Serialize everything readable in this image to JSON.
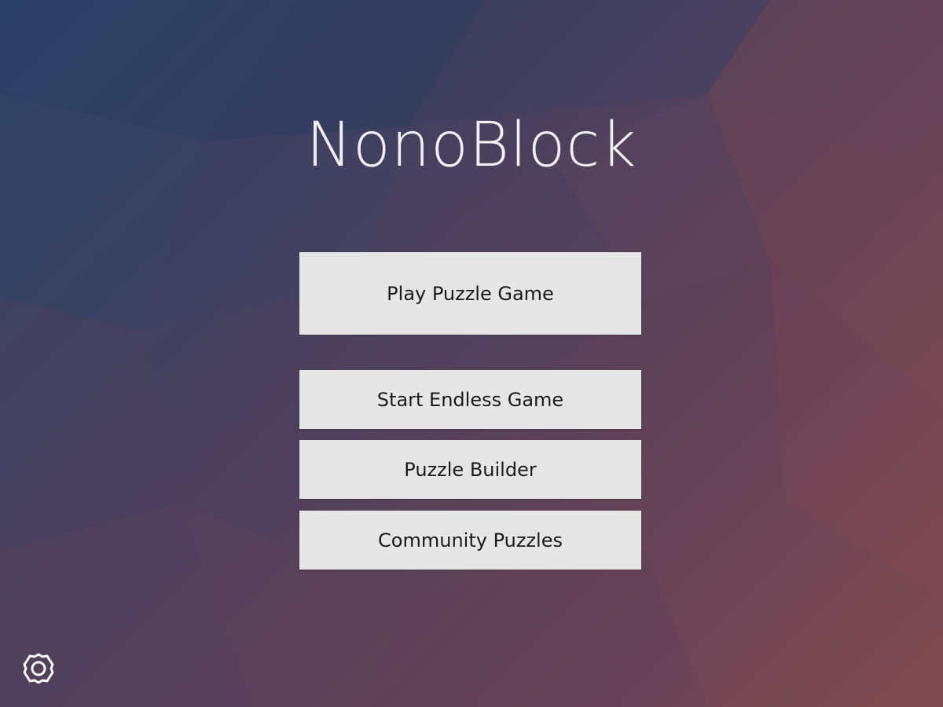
{
  "app": {
    "title": "NonoBlock"
  },
  "menu": {
    "play_label": "Play Puzzle Game",
    "endless_label": "Start Endless Game",
    "builder_label": "Puzzle Builder",
    "community_label": "Community Puzzles"
  },
  "icons": {
    "settings": "gear-icon"
  },
  "colors": {
    "button_bg": "#e6e6e6",
    "button_text": "#1b1b1b",
    "title_text": "#f2f0f4",
    "bg_top_left": "#2f4468",
    "bg_bottom_right": "#8a4e4c"
  }
}
